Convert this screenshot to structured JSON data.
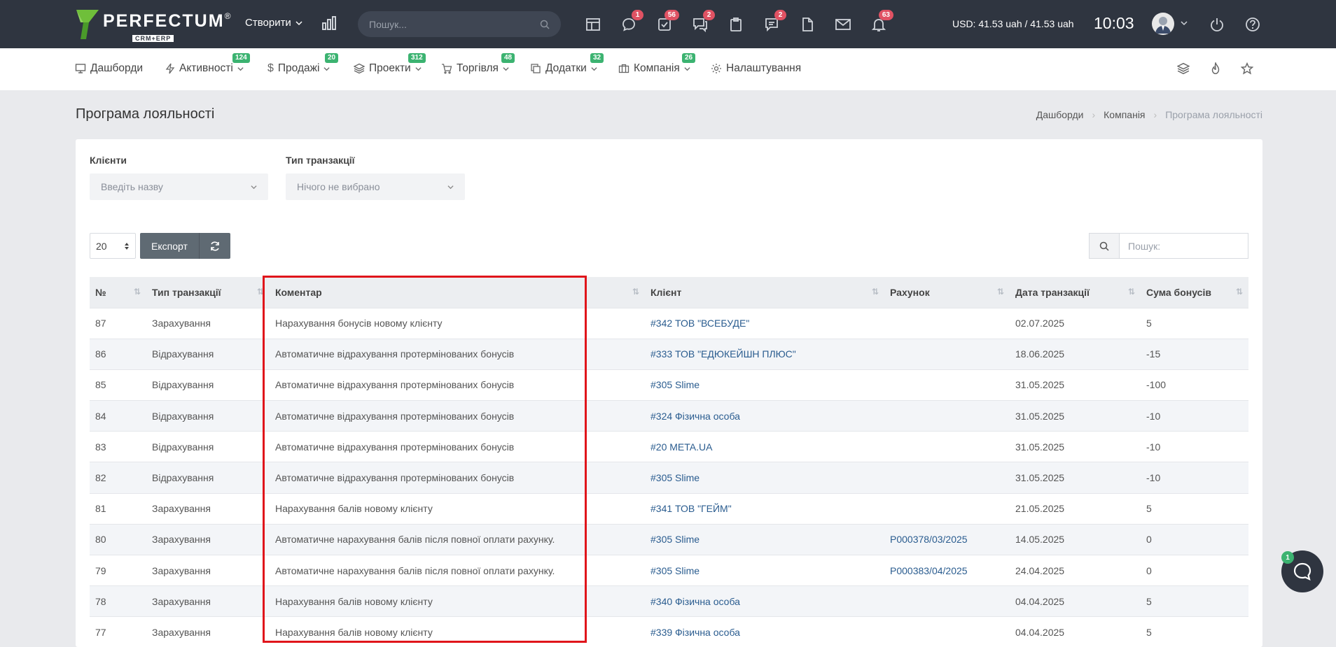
{
  "topbar": {
    "logo_name": "PERFECTUM",
    "logo_reg": "®",
    "logo_sub": "CRM+ERP",
    "create_label": "Створити",
    "search_placeholder": "Пошук...",
    "badges": {
      "chat": "1",
      "tasks": "56",
      "messages": "2",
      "comments": "2",
      "notifications": "63"
    },
    "currency": "USD: 41.53 uah / 41.53 uah",
    "clock": "10:03"
  },
  "nav": {
    "items": [
      {
        "label": "Дашборди",
        "badge": ""
      },
      {
        "label": "Активності",
        "badge": "124"
      },
      {
        "label": "Продажі",
        "badge": "20"
      },
      {
        "label": "Проекти",
        "badge": "312"
      },
      {
        "label": "Торгівля",
        "badge": "48"
      },
      {
        "label": "Додатки",
        "badge": "32"
      },
      {
        "label": "Компанія",
        "badge": "26"
      },
      {
        "label": "Налаштування",
        "badge": ""
      }
    ]
  },
  "page": {
    "title": "Програма лояльності",
    "breadcrumb": [
      "Дашборди",
      "Компанія",
      "Програма лояльності"
    ]
  },
  "filters": {
    "clients_label": "Клієнти",
    "clients_placeholder": "Введіть назву",
    "type_label": "Тип транзакції",
    "type_placeholder": "Нічого не вибрано"
  },
  "toolbar": {
    "page_size": "20",
    "export_label": "Експорт",
    "search_placeholder": "Пошук:"
  },
  "table": {
    "columns": [
      "№",
      "Тип транзакції",
      "Коментар",
      "Клієнт",
      "Рахунок",
      "Дата транзакції",
      "Сума бонусів"
    ],
    "rows": [
      [
        "87",
        "Зарахування",
        "Нарахування бонусів новому клієнту",
        "#342 ТОВ \"ВСЕБУДЕ\"",
        "",
        "02.07.2025",
        "5"
      ],
      [
        "86",
        "Відрахування",
        "Автоматичне відрахування протермінованих бонусів",
        "#333 ТОВ \"ЕДЮКЕЙШН ПЛЮС\"",
        "",
        "18.06.2025",
        "-15"
      ],
      [
        "85",
        "Відрахування",
        "Автоматичне відрахування протермінованих бонусів",
        "#305 Slime",
        "",
        "31.05.2025",
        "-100"
      ],
      [
        "84",
        "Відрахування",
        "Автоматичне відрахування протермінованих бонусів",
        "#324 Фізична особа",
        "",
        "31.05.2025",
        "-10"
      ],
      [
        "83",
        "Відрахування",
        "Автоматичне відрахування протермінованих бонусів",
        "#20 META.UA",
        "",
        "31.05.2025",
        "-10"
      ],
      [
        "82",
        "Відрахування",
        "Автоматичне відрахування протермінованих бонусів",
        "#305 Slime",
        "",
        "31.05.2025",
        "-10"
      ],
      [
        "81",
        "Зарахування",
        "Нарахування балів новому клієнту",
        "#341 ТОВ \"ГЕЙМ\"",
        "",
        "21.05.2025",
        "5"
      ],
      [
        "80",
        "Зарахування",
        "Автоматичне нарахування балів після повної оплати рахунку.",
        "#305 Slime",
        "P000378/03/2025",
        "14.05.2025",
        "0"
      ],
      [
        "79",
        "Зарахування",
        "Автоматичне нарахування балів після повної оплати рахунку.",
        "#305 Slime",
        "P000383/04/2025",
        "24.04.2025",
        "0"
      ],
      [
        "78",
        "Зарахування",
        "Нарахування балів новому клієнту",
        "#340 Фізична особа",
        "",
        "04.04.2025",
        "5"
      ],
      [
        "77",
        "Зарахування",
        "Нарахування балів новому клієнту",
        "#339 Фізична особа",
        "",
        "04.04.2025",
        "5"
      ]
    ]
  },
  "chat_widget": {
    "badge": "1"
  },
  "colors": {
    "topbar": "#2f3540",
    "accent_green": "#3cb371",
    "badge_red": "#e05263",
    "highlight": "#e0151b",
    "link": "#2a5c8f"
  }
}
